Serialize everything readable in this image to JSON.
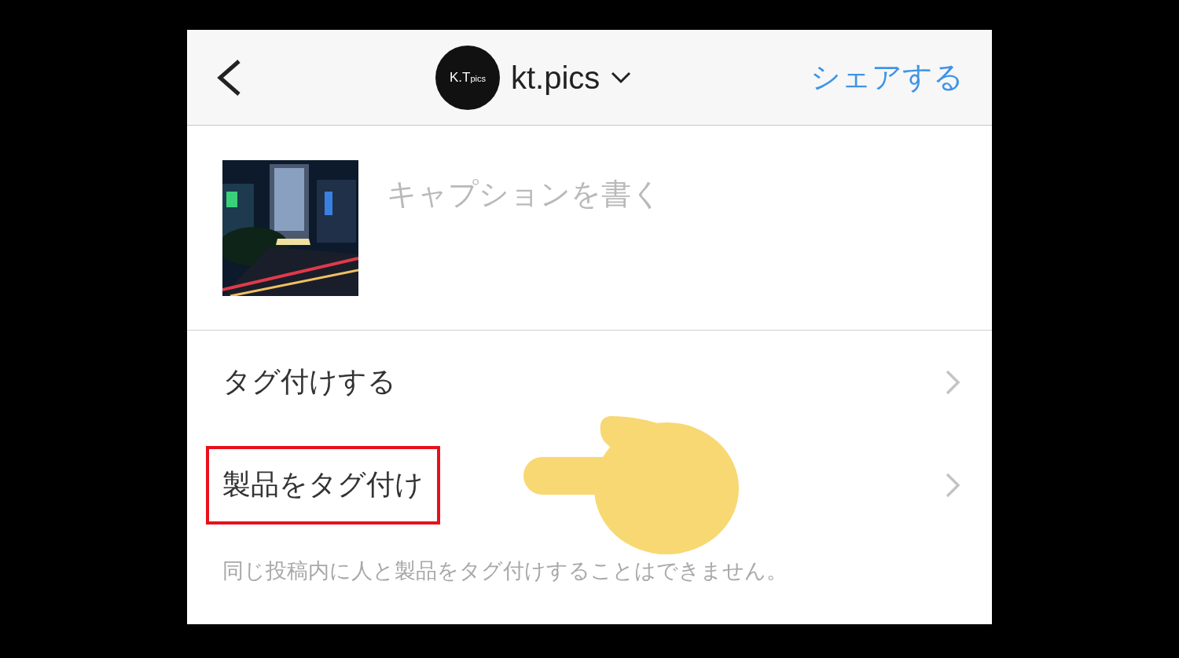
{
  "header": {
    "avatar_text": "K.T",
    "avatar_subtext": "pics",
    "username": "kt.pics",
    "share": "シェアする"
  },
  "caption": {
    "placeholder": "キャプションを書く"
  },
  "rows": [
    {
      "label": "タグ付けする",
      "highlighted": false
    },
    {
      "label": "製品をタグ付け",
      "highlighted": true
    }
  ],
  "note": "同じ投稿内に人と製品をタグ付けすることはできません。"
}
